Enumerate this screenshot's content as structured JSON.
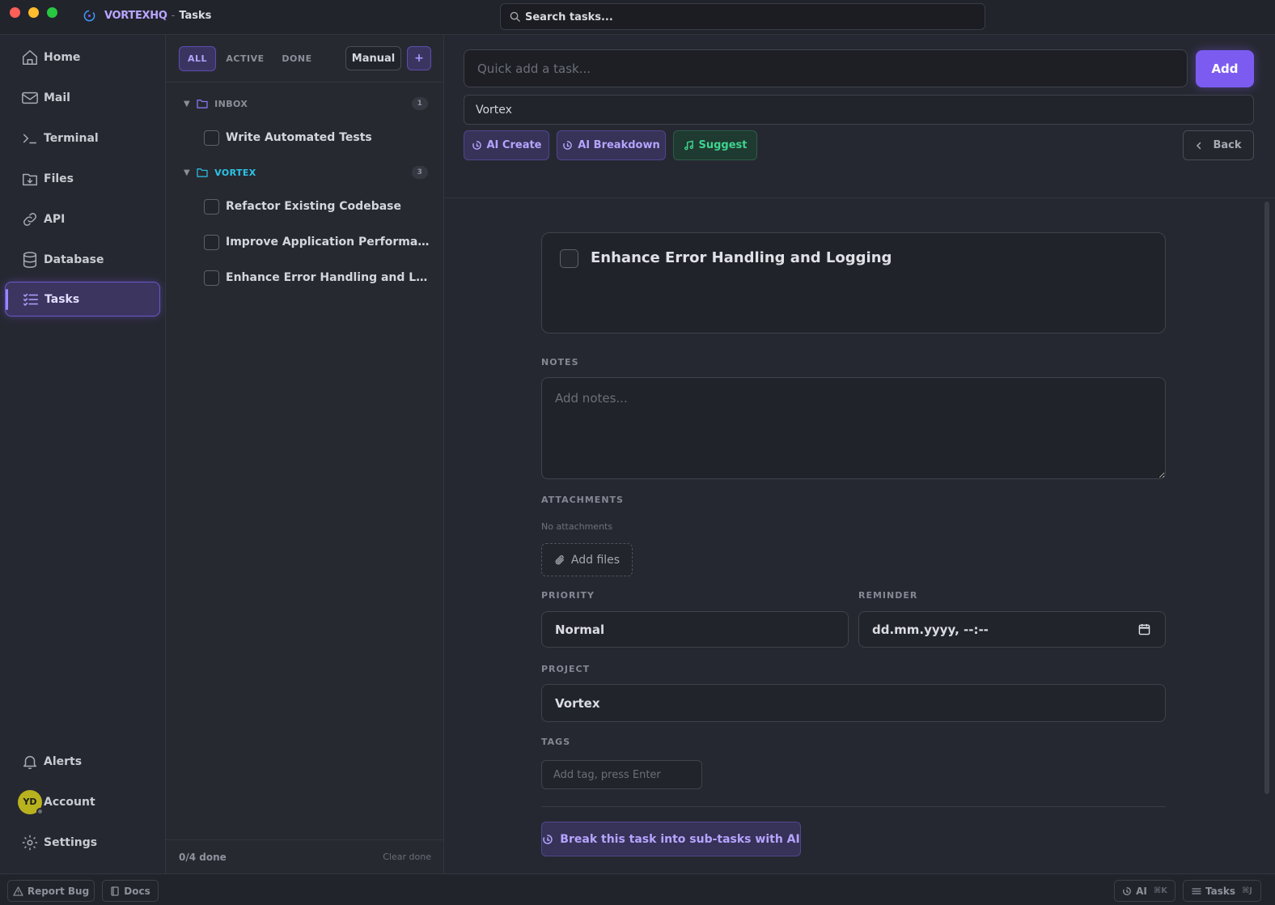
{
  "titlebar": {
    "brand": "VORTEXHQ",
    "separator": "-",
    "section": "Tasks",
    "search_placeholder": "Search tasks..."
  },
  "sidebar": {
    "items": [
      {
        "label": "Home",
        "icon": "home-icon"
      },
      {
        "label": "Mail",
        "icon": "mail-icon"
      },
      {
        "label": "Terminal",
        "icon": "terminal-icon"
      },
      {
        "label": "Files",
        "icon": "files-icon"
      },
      {
        "label": "API",
        "icon": "link-icon"
      },
      {
        "label": "Database",
        "icon": "database-icon"
      },
      {
        "label": "Tasks",
        "icon": "tasks-icon",
        "active": true
      }
    ],
    "bottom": {
      "alerts": "Alerts",
      "account": "Account",
      "avatar_initials": "YD",
      "settings": "Settings"
    }
  },
  "taskList": {
    "filters": [
      "ALL",
      "ACTIVE",
      "DONE"
    ],
    "active_filter": "ALL",
    "sort": "Manual",
    "add_symbol": "+",
    "groups": [
      {
        "name": "INBOX",
        "count": "1",
        "color": "#8c8f99",
        "tasks": [
          "Write Automated Tests"
        ]
      },
      {
        "name": "VORTEX",
        "count": "3",
        "color": "#2cc4e8",
        "tasks": [
          "Refactor Existing Codebase",
          "Improve Application Performance",
          "Enhance Error Handling and Logging"
        ]
      }
    ],
    "footer": {
      "progress": "0/4 done",
      "clear": "Clear done"
    }
  },
  "main": {
    "quick_add_placeholder": "Quick add a task...",
    "add_label": "Add",
    "project_value": "Vortex",
    "ai_create": "AI Create",
    "ai_breakdown": "AI Breakdown",
    "suggest": "Suggest",
    "back": "Back",
    "detail": {
      "title": "Enhance Error Handling and Logging",
      "notes_label": "NOTES",
      "notes_placeholder": "Add notes...",
      "attachments_label": "ATTACHMENTS",
      "no_attachments": "No attachments",
      "add_files": "Add files",
      "priority_label": "PRIORITY",
      "priority_value": "Normal",
      "reminder_label": "REMINDER",
      "reminder_value": "dd.mm.yyyy, --:--",
      "project_label": "PROJECT",
      "project_value": "Vortex",
      "tags_label": "TAGS",
      "tags_placeholder": "Add tag, press Enter",
      "breakdown_button": "Break this task into sub-tasks with AI"
    }
  },
  "statusbar": {
    "report_bug": "Report Bug",
    "docs": "Docs",
    "ai": "AI",
    "ai_shortcut": "⌘K",
    "tasks": "Tasks",
    "tasks_shortcut": "⌘J"
  },
  "colors": {
    "accent": "#7c5cf0",
    "accent_light": "#b5a4ff",
    "success": "#3ed391",
    "vortex_group": "#2cc4e8",
    "background": "#262831"
  }
}
